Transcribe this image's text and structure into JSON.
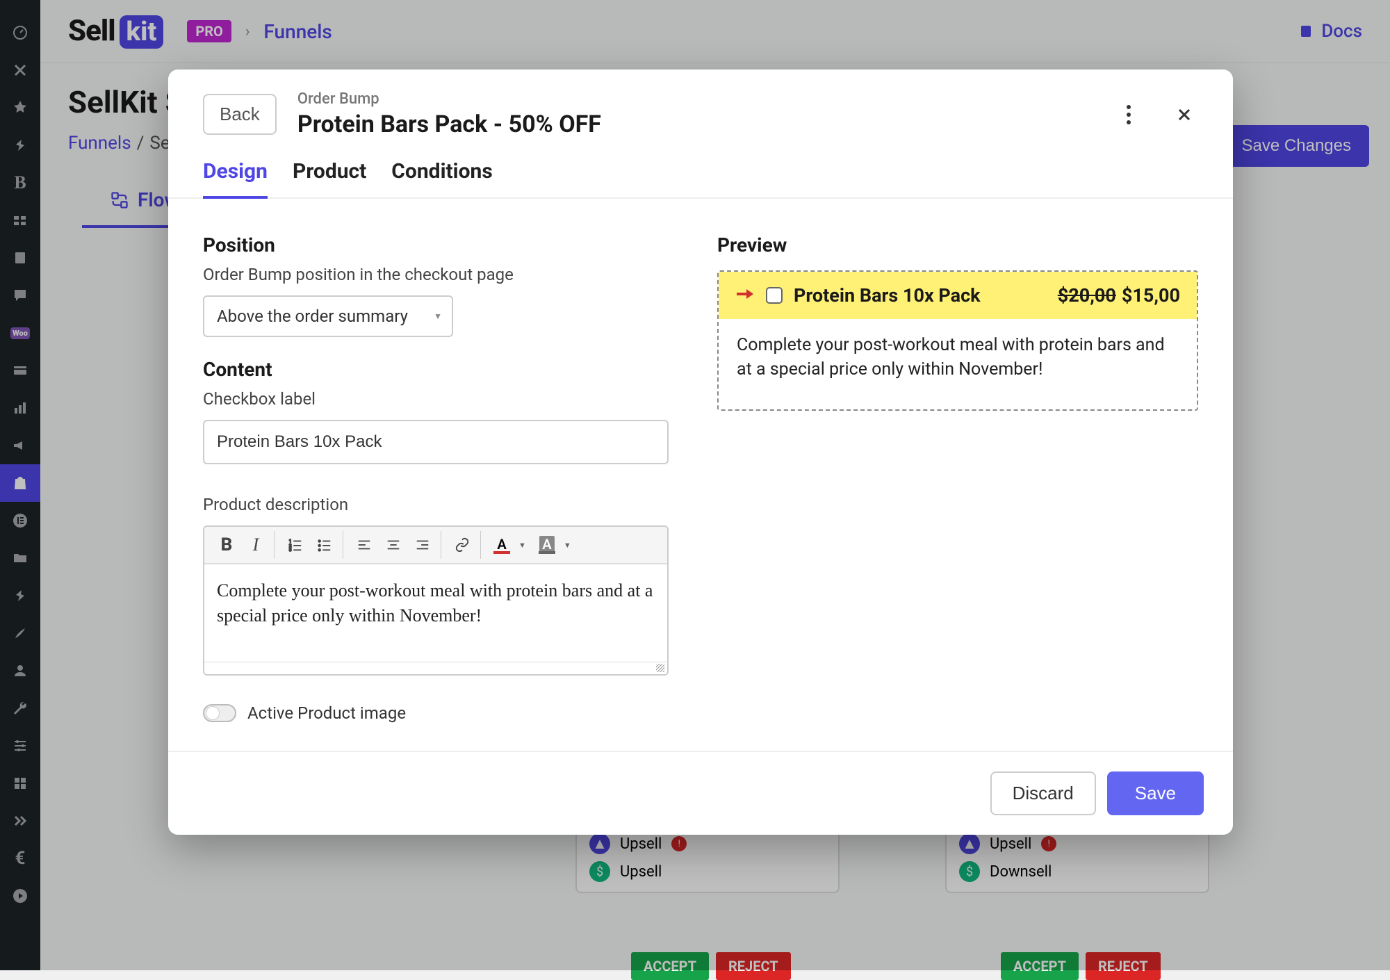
{
  "sidebar": {
    "items": [
      "dashboard",
      "x",
      "pin",
      "pin2",
      "bold",
      "settings",
      "book",
      "comment",
      "woo",
      "card",
      "stats",
      "megaphone",
      "bag",
      "elementor",
      "folder",
      "tool",
      "edit",
      "user",
      "wrench",
      "sliders",
      "grid",
      "double",
      "euro",
      "play"
    ]
  },
  "topbar": {
    "logo_sell": "Sell",
    "logo_kit": "kit",
    "badge_pro": "PRO",
    "breadcrumb_link": "Funnels",
    "docs_label": "Docs"
  },
  "page": {
    "title_partial": "SellKit S",
    "crumb_funnels": "Funnels",
    "crumb_current": "SellK",
    "save_changes": "Save Changes",
    "flow_tab": "Flow"
  },
  "modal": {
    "back": "Back",
    "eyebrow": "Order Bump",
    "title": "Protein Bars Pack - 50% OFF",
    "tabs": {
      "design": "Design",
      "product": "Product",
      "conditions": "Conditions"
    }
  },
  "design": {
    "position_title": "Position",
    "position_sub": "Order Bump position in the checkout page",
    "position_value": "Above the order summary",
    "content_title": "Content",
    "checkbox_label_lbl": "Checkbox label",
    "checkbox_label_val": "Protein Bars 10x Pack",
    "desc_label": "Product description",
    "desc_text": "Complete your post-workout meal with protein bars and at a special price only within November!",
    "toggle_label": "Active Product image"
  },
  "preview": {
    "title": "Preview",
    "label": "Protein Bars 10x Pack",
    "price_old": "$20,00",
    "price_new": "$15,00",
    "body": "Complete your post-workout meal with protein bars and at a special price only within November!"
  },
  "footer": {
    "discard": "Discard",
    "save": "Save"
  },
  "funnel": {
    "upsell": "Upsell",
    "downsell": "Downsell",
    "accept": "ACCEPT",
    "reject": "REJECT"
  }
}
